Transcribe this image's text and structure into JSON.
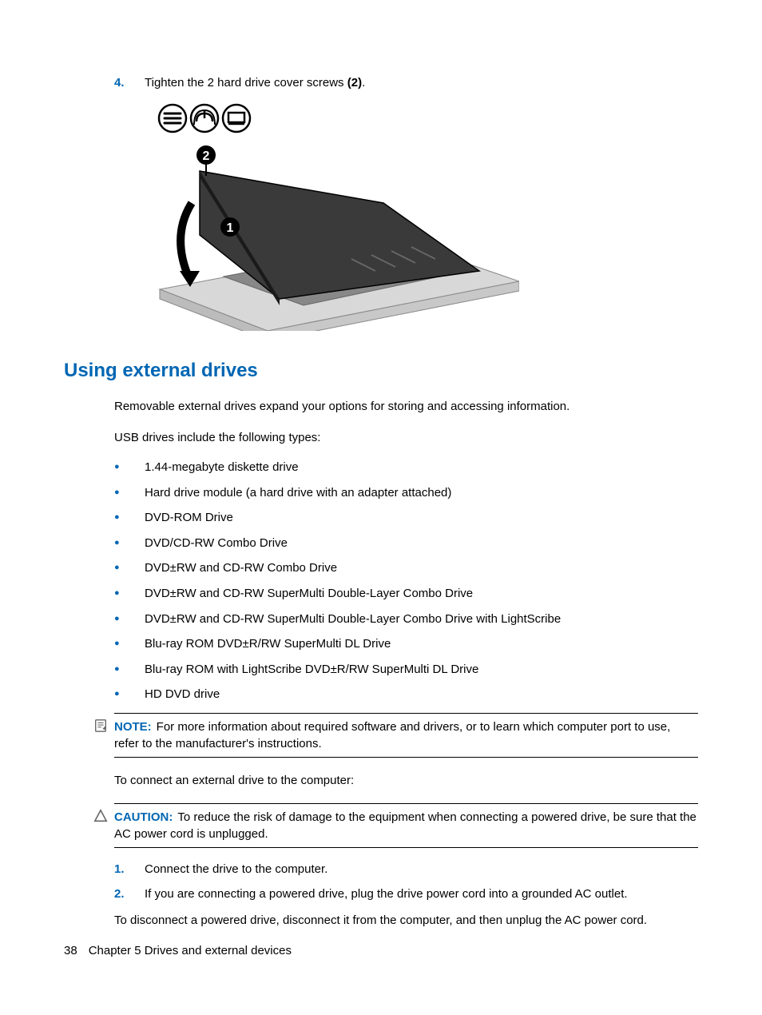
{
  "step4": {
    "num": "4.",
    "text_before": "Tighten the 2 hard drive cover screws ",
    "text_bold": "(2)",
    "text_after": "."
  },
  "section_heading": "Using external drives",
  "intro_para": "Removable external drives expand your options for storing and accessing information.",
  "usb_para": "USB drives include the following types:",
  "bullets": [
    "1.44-megabyte diskette drive",
    "Hard drive module (a hard drive with an adapter attached)",
    "DVD-ROM Drive",
    "DVD/CD-RW Combo Drive",
    "DVD±RW and CD-RW Combo Drive",
    "DVD±RW and CD-RW SuperMulti Double-Layer Combo Drive",
    "DVD±RW and CD-RW SuperMulti Double-Layer Combo Drive with LightScribe",
    "Blu-ray ROM DVD±R/RW SuperMulti DL Drive",
    "Blu-ray ROM with LightScribe DVD±R/RW SuperMulti DL Drive",
    "HD DVD drive"
  ],
  "note": {
    "label": "NOTE:",
    "text": "For more information about required software and drivers, or to learn which computer port to use, refer to the manufacturer's instructions."
  },
  "connect_para": "To connect an external drive to the computer:",
  "caution": {
    "label": "CAUTION:",
    "text": "To reduce the risk of damage to the equipment when connecting a powered drive, be sure that the AC power cord is unplugged."
  },
  "ol_items": [
    {
      "num": "1.",
      "text": "Connect the drive to the computer."
    },
    {
      "num": "2.",
      "text": "If you are connecting a powered drive, plug the drive power cord into a grounded AC outlet."
    }
  ],
  "disconnect_para": "To disconnect a powered drive, disconnect it from the computer, and then unplug the AC power cord.",
  "footer": {
    "page": "38",
    "chapter": "Chapter 5   Drives and external devices"
  }
}
